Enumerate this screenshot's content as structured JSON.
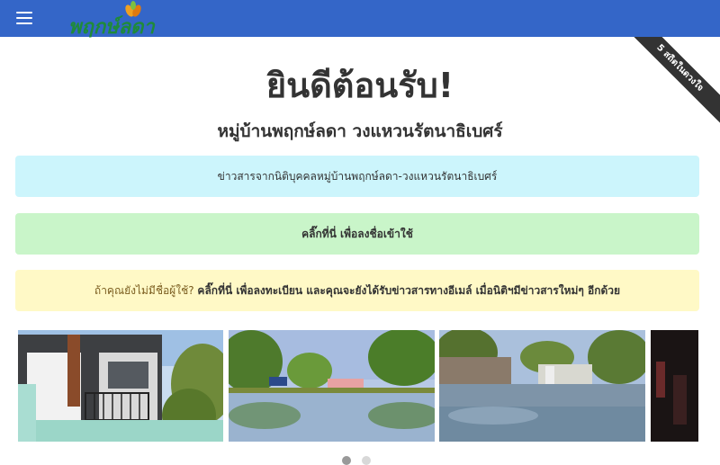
{
  "header": {
    "menu_icon": "hamburger-menu-icon",
    "logo_text": "พฤกษ์ลดา",
    "brand_color": "#3466c8",
    "logo_color": "#1f8a3a"
  },
  "ribbon": {
    "text": "5 สถิตในดวงใจ"
  },
  "main": {
    "title": "ยินดีต้อนรับ!",
    "subtitle": "หมู่บ้านพฤกษ์ลดา วงแหวนรัตนาธิเบศร์"
  },
  "alerts": {
    "news": "ข่าวสารจากนิติบุคคลหมู่บ้านพฤกษ์ลดา-วงแหวนรัตนาธิเบศร์",
    "login": "คลิ๊กที่นี่ เพื่อลงชื่อเข้าใช้",
    "register_prefix": "ถ้าคุณยังไม่มีชื่อผู้ใช้?",
    "register_link": "คลิ๊กที่นี่ เพื่อลงทะเบียน และคุณจะยังได้รับข่าวสารทางอีเมล์ เมื่อนิติฯมีข่าวสารใหม่ๆ อีกด้วย"
  },
  "carousel": {
    "slides": [
      "house-photo",
      "flooded-park-photo",
      "flooded-street-photo",
      "dark-photo"
    ],
    "active_index": 0,
    "dot_count": 2
  }
}
